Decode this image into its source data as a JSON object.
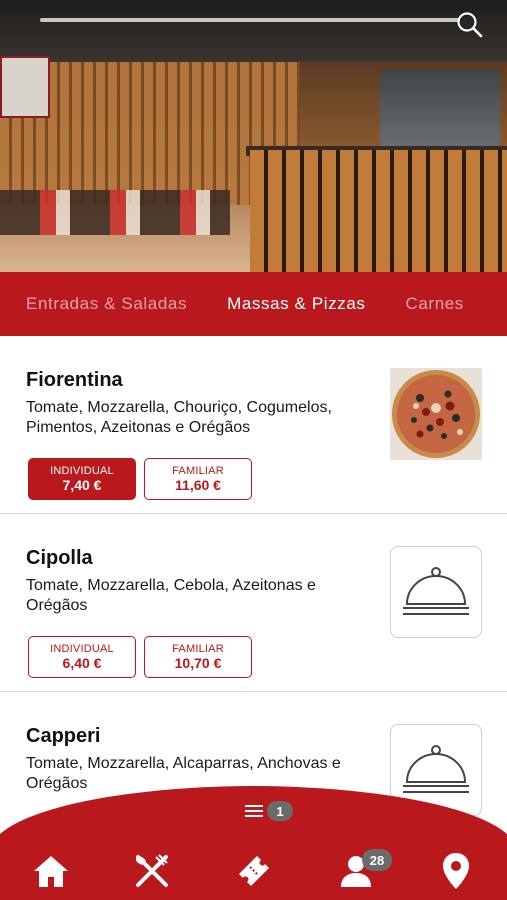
{
  "header": {
    "search_icon": "search-icon"
  },
  "tabs": [
    {
      "label": "Entradas & Saladas",
      "active": false
    },
    {
      "label": "Massas & Pizzas",
      "active": true
    },
    {
      "label": "Carnes",
      "active": false
    }
  ],
  "items": [
    {
      "name": "Fiorentina",
      "description": "Tomate, Mozzarella, Chouriço, Cogumelos, Pimentos, Azeitonas e Orégãos",
      "image": "pizza-photo",
      "prices": [
        {
          "label": "INDIVIDUAL",
          "value": "7,40 €",
          "selected": true
        },
        {
          "label": "FAMILIAR",
          "value": "11,60 €",
          "selected": false
        }
      ]
    },
    {
      "name": "Cipolla",
      "description": "Tomate, Mozzarella, Cebola, Azeitonas e Orégãos",
      "image": "cloche-icon",
      "prices": [
        {
          "label": "INDIVIDUAL",
          "value": "6,40 €",
          "selected": false
        },
        {
          "label": "FAMILIAR",
          "value": "10,70 €",
          "selected": false
        }
      ]
    },
    {
      "name": "Capperi",
      "description": "Tomate, Mozzarella, Alcaparras, Anchovas e Orégãos",
      "image": "cloche-icon",
      "prices": []
    }
  ],
  "cart": {
    "icon": "menu-lines-icon",
    "count": "1"
  },
  "bottom_nav": {
    "items": [
      {
        "icon": "home-icon"
      },
      {
        "icon": "cutlery-icon"
      },
      {
        "icon": "ticket-icon"
      },
      {
        "icon": "user-icon",
        "badge": "28"
      },
      {
        "icon": "location-pin-icon"
      }
    ]
  },
  "colors": {
    "brand": "#b9191c",
    "badge": "#6b6b6b"
  }
}
